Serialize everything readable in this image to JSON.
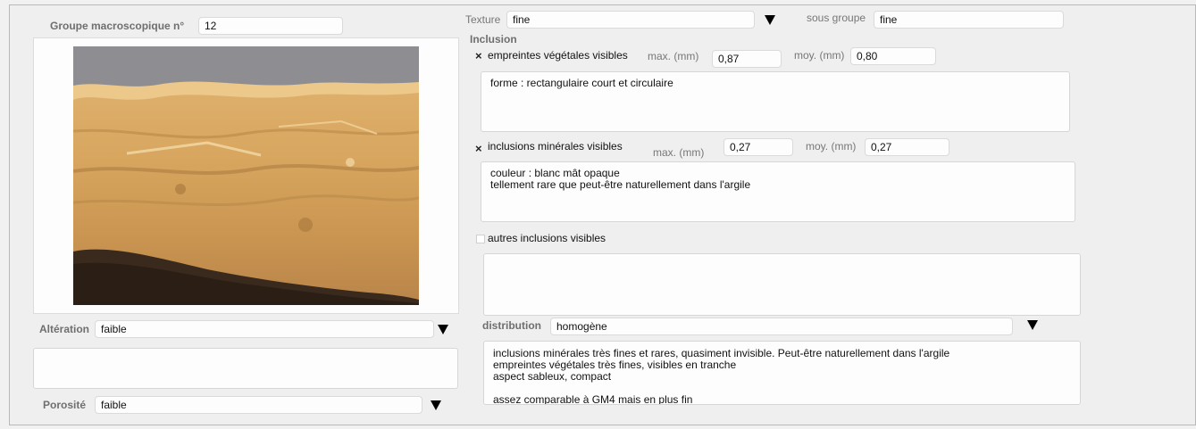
{
  "groupe": {
    "label": "Groupe macroscopique n°",
    "value": "12"
  },
  "texture": {
    "label": "Texture",
    "value": "fine"
  },
  "sous_groupe": {
    "label": "sous groupe",
    "value": "fine"
  },
  "inclusion": {
    "heading": "Inclusion",
    "vegetales": {
      "checked": true,
      "check_mark": "×",
      "label": "empreintes végétales visibles",
      "max_label": "max. (mm)",
      "max_value": "0,87",
      "moy_label": "moy. (mm)",
      "moy_value": "0,80",
      "notes": "forme : rectangulaire court et circulaire"
    },
    "minerales": {
      "checked": true,
      "check_mark": "×",
      "label": "inclusions minérales visibles",
      "max_label": "max. (mm)",
      "max_value": "0,27",
      "moy_label": "moy. (mm)",
      "moy_value": "0,27",
      "notes": "couleur : blanc mât opaque\ntellement rare que peut-être naturellement dans l'argile"
    },
    "autres": {
      "checked": false,
      "label": "autres inclusions visibles",
      "notes": ""
    }
  },
  "distribution": {
    "label": "distribution",
    "value": "homogène",
    "notes": "inclusions minérales très fines et rares, quasiment invisible. Peut-être naturellement dans l'argile\nempreintes végétales très fines, visibles en tranche\naspect sableux, compact\n\nassez comparable à GM4 mais en plus fin"
  },
  "alteration": {
    "label": "Altération",
    "value": "faible",
    "notes": ""
  },
  "porosite": {
    "label": "Porosité",
    "value": "faible"
  },
  "photo": {
    "alt": "macroscopic-sample-photo"
  }
}
